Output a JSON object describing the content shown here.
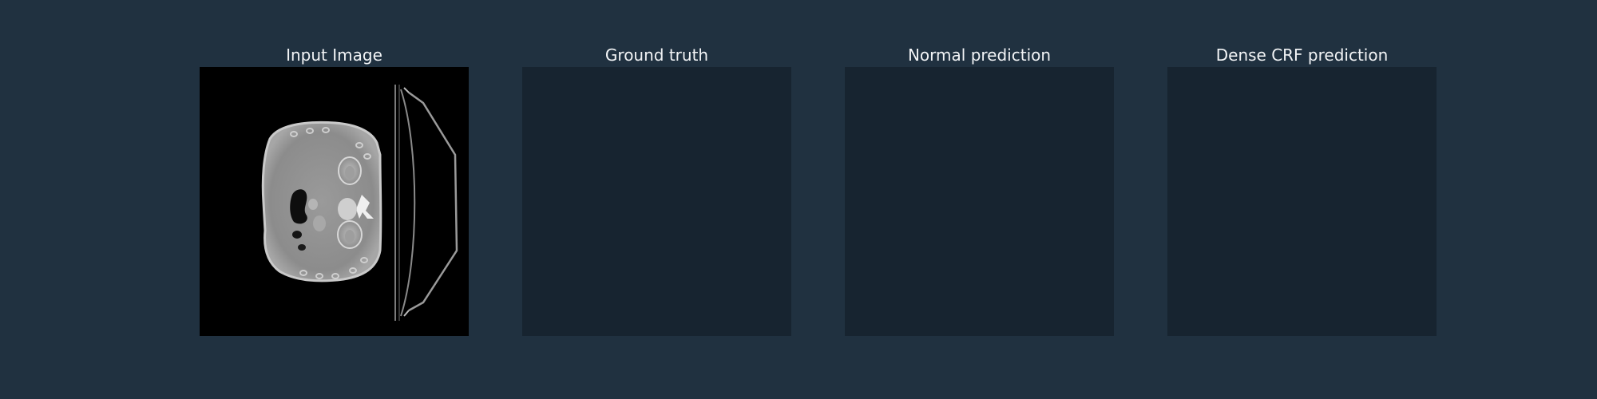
{
  "figure": {
    "background_color": "#203140",
    "empty_panel_color": "#172430",
    "title_color": "#f2f4f6",
    "panels": [
      {
        "title": "Input Image",
        "content": "ct-scan"
      },
      {
        "title": "Ground truth",
        "content": "empty"
      },
      {
        "title": "Normal prediction",
        "content": "empty"
      },
      {
        "title": "Dense CRF prediction",
        "content": "empty"
      }
    ]
  }
}
